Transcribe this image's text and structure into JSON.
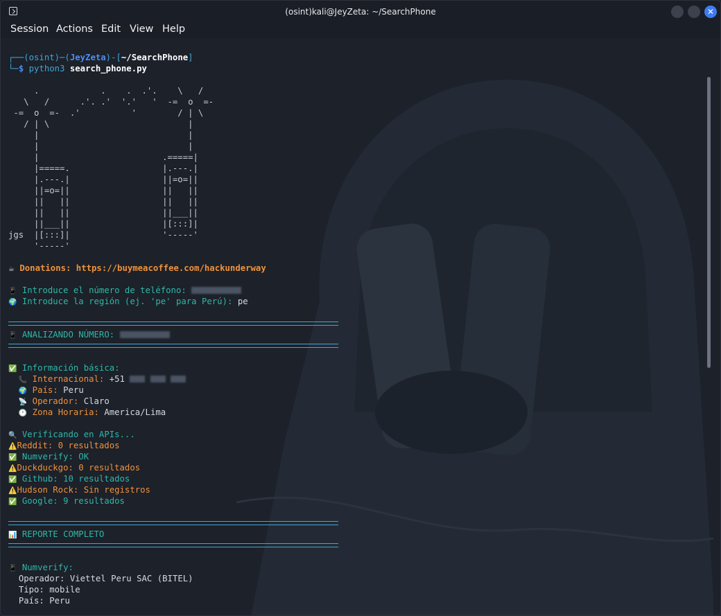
{
  "window": {
    "title": "(osint)kali@JeyZeta: ~/SearchPhone",
    "buttons": [
      "−",
      "□",
      "✕"
    ]
  },
  "menu": [
    "Session",
    "Actions",
    "Edit",
    "View",
    "Help"
  ],
  "prompt": {
    "line1_pre": "┌──(osint)─(",
    "user": "JeyZeta",
    "line1_mid": ")-[",
    "path": "~/SearchPhone",
    "line1_post": "]",
    "line2_pre": "└─",
    "dollar": "$",
    "cmd": "python3",
    "arg": "search_phone.py"
  },
  "ascii_art": [
    "     .            .    .  .'.    \\   /",
    "   \\   /      .'. .'  '.'   '  -=  o  =-",
    " -=  o  =-  .'          '        / | \\",
    "   / | \\                           |",
    "     |                             |",
    "     |                             |",
    "     |                        .=====|",
    "     |=====.                  |.---.|",
    "     |.---.|                  ||=o=||",
    "     ||=o=||                  ||   ||",
    "     ||   ||                  ||   ||",
    "     ||   ||                  ||___||",
    "     ||___||                  |[:::]|",
    "jgs  |[:::]|                  '-----'",
    "     '-----'"
  ],
  "donations": {
    "icon": "☕",
    "text": "Donations: https://buymeacoffee.com/hackunderway"
  },
  "inputs": {
    "phone_icon": "📱",
    "phone_label": "Introduce el número de teléfono: ",
    "region_icon": "🌍",
    "region_label": "Introduce la región (ej. 'pe' para Perú): ",
    "region_value": "pe"
  },
  "analyzing": {
    "icon": "📱",
    "label": "ANALIZANDO NÚMERO: "
  },
  "basic": {
    "icon": "✅",
    "title": "Información básica:",
    "rows": [
      {
        "icon": "📞",
        "key": "Internacional:",
        "value": "+51"
      },
      {
        "icon": "🌍",
        "key": "País:",
        "value": "Peru"
      },
      {
        "icon": "📡",
        "key": "Operador:",
        "value": "Claro"
      },
      {
        "icon": "🕐",
        "key": "Zona Horaria:",
        "value": "America/Lima"
      }
    ]
  },
  "apis": {
    "icon": "🔍",
    "title": "Verificando en APIs...",
    "results": [
      {
        "icon": "⚠️",
        "text": "Reddit: 0 resultados",
        "color": "#f0923a"
      },
      {
        "icon": "✅",
        "text": " Numverify: OK",
        "color": "#2fb8a7"
      },
      {
        "icon": "⚠️",
        "text": "Duckduckgo: 0 resultados",
        "color": "#f0923a"
      },
      {
        "icon": "✅",
        "text": " Github: 10 resultados",
        "color": "#2fb8a7"
      },
      {
        "icon": "⚠️",
        "text": "Hudson Rock: Sin registros",
        "color": "#f0923a"
      },
      {
        "icon": "✅",
        "text": " Google: 9 resultados",
        "color": "#2fb8a7"
      }
    ]
  },
  "report": {
    "icon": "📊",
    "title": "REPORTE COMPLETO"
  },
  "numverify": {
    "icon": "📱",
    "title": "Numverify:",
    "rows": [
      "Operador: Viettel Peru SAC (BITEL)",
      "Tipo: mobile",
      "País: Peru"
    ]
  },
  "colors": {
    "cyan": "#3fa7d6",
    "teal": "#2fb8a7",
    "orange": "#f0923a",
    "blue": "#4e8cf0"
  }
}
